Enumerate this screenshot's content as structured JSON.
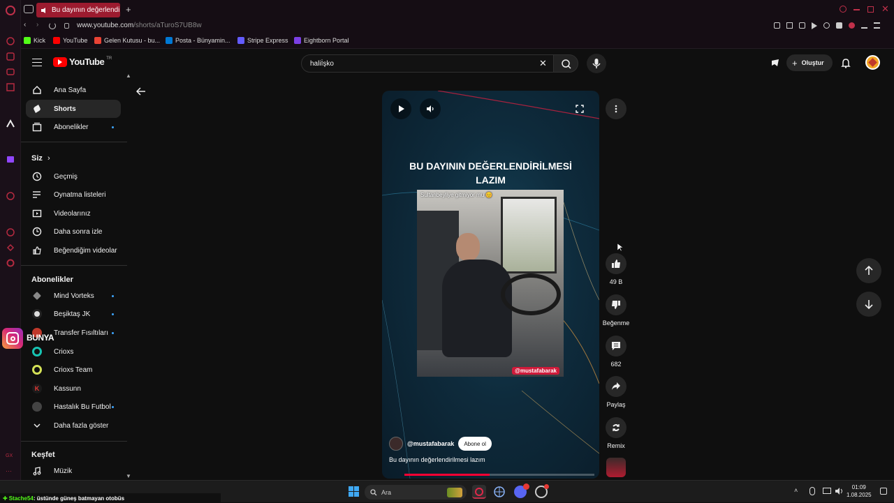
{
  "browser": {
    "tab_title": "Bu dayının değerlendi",
    "url_host": "www.youtube.com",
    "url_path": "/shorts/aTuroS7UB8w",
    "bookmarks": [
      {
        "label": "Kick",
        "color": "#53fc18"
      },
      {
        "label": "YouTube",
        "color": "#ff0000"
      },
      {
        "label": "Gelen Kutusu - bu...",
        "color": "#ea4335"
      },
      {
        "label": "Posta - Bünyamin...",
        "color": "#0078d4"
      },
      {
        "label": "Stripe Express",
        "color": "#635bff"
      },
      {
        "label": "Eightborn Portal",
        "color": "#7b3fe4"
      }
    ]
  },
  "youtube": {
    "logo": "YouTube",
    "country": "TR",
    "search_value": "haliİşko",
    "create_label": "Oluştur",
    "sidebar": {
      "main": [
        {
          "label": "Ana Sayfa",
          "icon": "home-icon"
        },
        {
          "label": "Shorts",
          "icon": "shorts-icon",
          "active": true
        },
        {
          "label": "Abonelikler",
          "icon": "subscriptions-icon",
          "dot": true
        }
      ],
      "you_heading": "Siz",
      "you": [
        {
          "label": "Geçmiş",
          "icon": "history-icon"
        },
        {
          "label": "Oynatma listeleri",
          "icon": "playlists-icon"
        },
        {
          "label": "Videolarınız",
          "icon": "your-videos-icon"
        },
        {
          "label": "Daha sonra izle",
          "icon": "watch-later-icon"
        },
        {
          "label": "Beğendiğim videolar",
          "icon": "liked-videos-icon"
        }
      ],
      "subs_heading": "Abonelikler",
      "subs": [
        {
          "label": "Mind Vorteks",
          "color": "#888888",
          "dot": true
        },
        {
          "label": "Beşiktaş JK",
          "color": "#dddddd",
          "dot": true
        },
        {
          "label": "Transfer Fısıltıları",
          "color": "#c0392b",
          "dot": true
        },
        {
          "label": "Crioxs",
          "color": "#17c3b2",
          "dot": false
        },
        {
          "label": "Crioxs Team",
          "color": "#d4e157",
          "dot": false
        },
        {
          "label": "Kassunn",
          "color": "#e53935",
          "dot": false
        },
        {
          "label": "Hastalık Bu Futbol",
          "color": "#444444",
          "dot": true
        }
      ],
      "show_more": "Daha fazla göster",
      "explore_heading": "Keşfet",
      "explore": [
        {
          "label": "Müzik",
          "icon": "music-icon"
        }
      ]
    },
    "short": {
      "caption_line1": "BU DAYININ DEĞERLENDİRİLMESİ",
      "caption_line2": "LAZIM",
      "overlay_text": "Sultanbeyliye gitmiyor mu 😊",
      "watermark": "@mustafabarak",
      "channel": "@mustafabarak",
      "subscribe_label": "Abone ol",
      "title": "Bu dayının değerlendirilmesi lazım",
      "progress": 0.45
    },
    "actions": {
      "likes": "49 B",
      "dislike_label": "Beğenme",
      "comments": "682",
      "share_label": "Paylaş",
      "remix_label": "Remix"
    }
  },
  "overlay": {
    "insta_text": "BUNYA",
    "ticker_user": "Stache54",
    "ticker_msg": ": üstünde güneş batmayan otobüs"
  },
  "taskbar": {
    "search_placeholder": "Ara",
    "time": "01:09",
    "date": "1.08.2025"
  }
}
